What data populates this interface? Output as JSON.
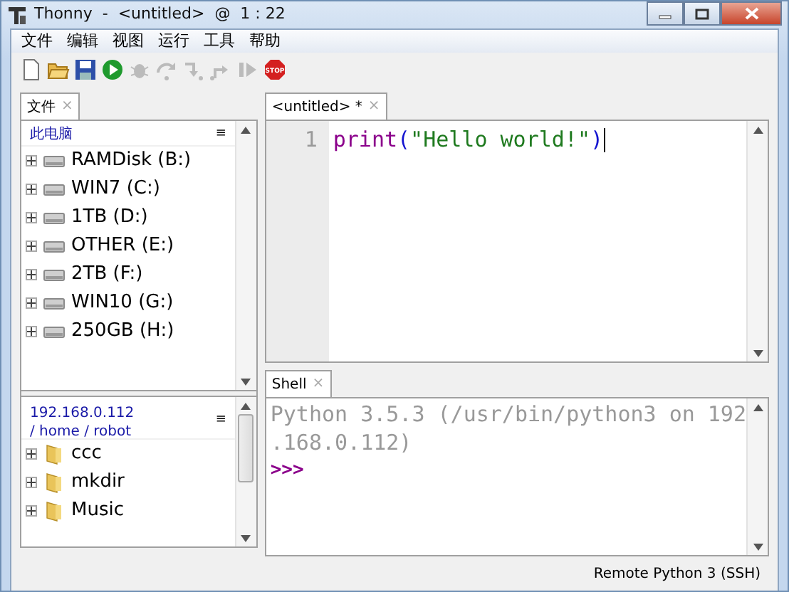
{
  "window": {
    "title": "Thonny  -  <untitled>  @  1 : 22"
  },
  "menu": [
    "文件",
    "编辑",
    "视图",
    "运行",
    "工具",
    "帮助"
  ],
  "toolbar": [
    {
      "kind": "new",
      "disabled": false
    },
    {
      "kind": "open",
      "disabled": false
    },
    {
      "kind": "save",
      "disabled": false
    },
    {
      "kind": "run",
      "disabled": false
    },
    {
      "kind": "debug",
      "disabled": true
    },
    {
      "kind": "step-over",
      "disabled": true
    },
    {
      "kind": "step-into",
      "disabled": true
    },
    {
      "kind": "step-out",
      "disabled": true
    },
    {
      "kind": "resume",
      "disabled": true
    },
    {
      "kind": "stop",
      "disabled": false,
      "label": "STOP"
    }
  ],
  "files": {
    "tab": "文件",
    "tab_close": "×",
    "local": {
      "header": "此电脑",
      "menu": "≡",
      "items": [
        {
          "label": "RAMDisk (B:)",
          "kind": "drive"
        },
        {
          "label": "WIN7 (C:)",
          "kind": "drive"
        },
        {
          "label": "1TB (D:)",
          "kind": "drive"
        },
        {
          "label": "OTHER (E:)",
          "kind": "drive"
        },
        {
          "label": "2TB (F:)",
          "kind": "drive"
        },
        {
          "label": "WIN10 (G:)",
          "kind": "drive"
        },
        {
          "label": "250GB (H:)",
          "kind": "drive"
        }
      ]
    },
    "remote": {
      "host": "192.168.0.112",
      "path": "/ home / robot",
      "menu": "≡",
      "items": [
        {
          "label": "ccc",
          "kind": "folder"
        },
        {
          "label": "mkdir",
          "kind": "folder"
        },
        {
          "label": "Music",
          "kind": "folder"
        }
      ]
    }
  },
  "editor": {
    "tab": "<untitled> *",
    "tab_close": "×",
    "lines": [
      {
        "number": "1",
        "tokens": [
          {
            "kind": "builtin",
            "text": "print"
          },
          {
            "kind": "paren",
            "text": "("
          },
          {
            "kind": "string",
            "text": "\"Hello world!\""
          },
          {
            "kind": "paren",
            "text": ")"
          }
        ]
      }
    ]
  },
  "shell": {
    "tab": "Shell",
    "tab_close": "×",
    "output": [
      "Python 3.5.3 (/usr/bin/python3 on 192",
      ".168.0.112)"
    ],
    "prompt": ">>>"
  },
  "status_bar": "Remote Python 3 (SSH)"
}
